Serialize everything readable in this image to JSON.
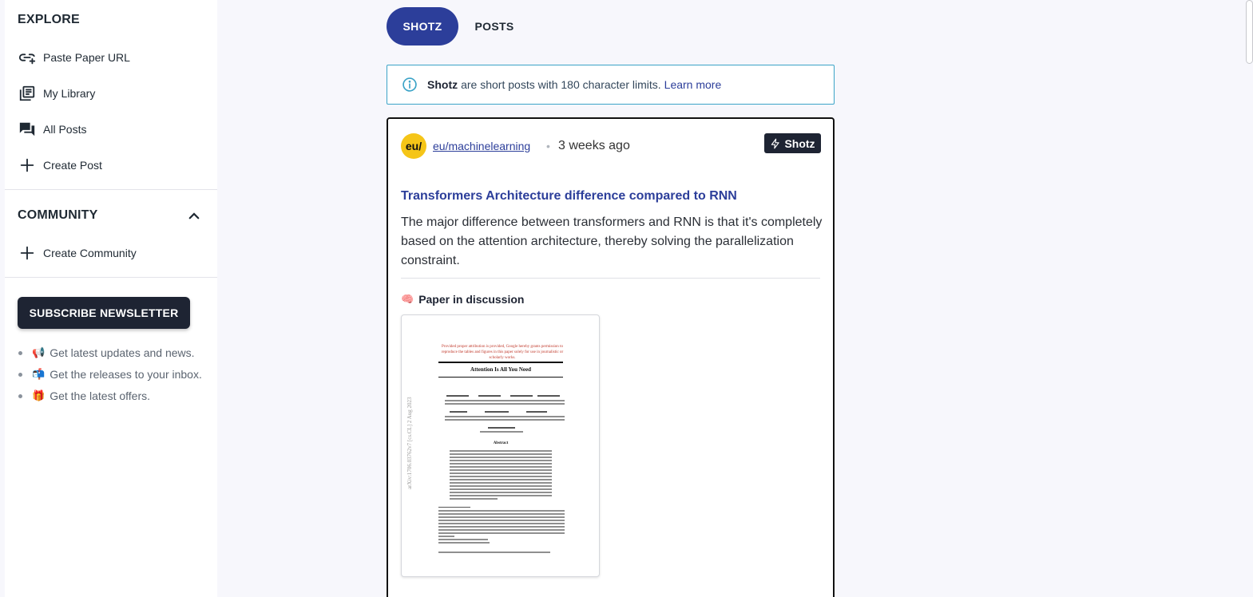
{
  "sidebar": {
    "explore_title": "EXPLORE",
    "explore_items": [
      {
        "label": "Paste Paper URL",
        "icon": "link-add-icon"
      },
      {
        "label": "My Library",
        "icon": "library-icon"
      },
      {
        "label": "All Posts",
        "icon": "forum-icon"
      },
      {
        "label": "Create Post",
        "icon": "plus-icon"
      }
    ],
    "community_title": "COMMUNITY",
    "community_items": [
      {
        "label": "Create Community",
        "icon": "plus-icon"
      }
    ],
    "subscribe_label": "SUBSCRIBE NEWSLETTER",
    "perks": [
      {
        "emoji": "📢",
        "text": "Get latest updates and news."
      },
      {
        "emoji": "📬",
        "text": "Get the releases to your inbox."
      },
      {
        "emoji": "🎁",
        "text": "Get the latest offers."
      }
    ]
  },
  "tabs": [
    {
      "label": "SHOTZ",
      "active": true
    },
    {
      "label": "POSTS",
      "active": false
    }
  ],
  "info": {
    "bold": "Shotz",
    "text": "are short posts with 180 character limits.",
    "link": "Learn more"
  },
  "post": {
    "avatar_text": "eu/",
    "community": "eu/machinelearning",
    "separator": "•",
    "time": "3 weeks ago",
    "badge": "Shotz",
    "title": "Transformers Architecture difference compared to RNN",
    "body": "The major difference between transformers and RNN is that it's completely based on the attention architecture, thereby solving the parallelization constraint.",
    "paper_label": "Paper in discussion",
    "paper_emoji": "🧠",
    "paper": {
      "notice": "Provided proper attribution is provided, Google hereby grants permission to reproduce the tables and figures in this paper solely for use in journalistic or scholarly works.",
      "title": "Attention Is All You Need",
      "arxiv": "arXiv:1706.03762v7 [cs.CL] 2 Aug 2023",
      "abstract_heading": "Abstract"
    }
  },
  "colors": {
    "accent": "#2c3e9a",
    "dark": "#1e2433",
    "info_border": "#3ba3c7",
    "avatar": "#f5c518"
  }
}
